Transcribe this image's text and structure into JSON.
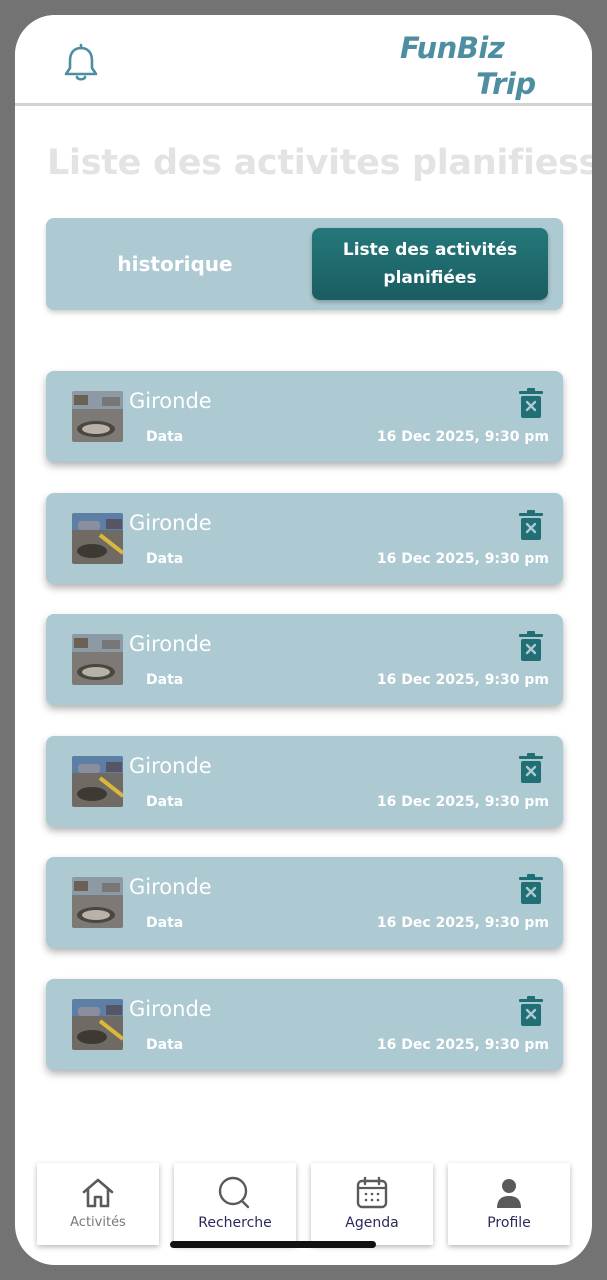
{
  "header": {
    "logo_line1": "FunBiz",
    "logo_line2": "Trip",
    "bell_icon": "bell-icon"
  },
  "page_title": "Liste des activites planifiess",
  "tabs": {
    "history_label": "historique",
    "planned_label_line1": "Liste des activités",
    "planned_label_line2": "planifiées"
  },
  "activities": [
    {
      "title": "Gironde",
      "subtitle": "Data",
      "date": "16 Dec 2025, 9:30 pm"
    },
    {
      "title": "Gironde",
      "subtitle": "Data",
      "date": "16 Dec 2025, 9:30 pm"
    },
    {
      "title": "Gironde",
      "subtitle": "Data",
      "date": "16 Dec 2025, 9:30 pm"
    },
    {
      "title": "Gironde",
      "subtitle": "Data",
      "date": "16 Dec 2025, 9:30 pm"
    },
    {
      "title": "Gironde",
      "subtitle": "Data",
      "date": "16 Dec 2025, 9:30 pm"
    },
    {
      "title": "Gironde",
      "subtitle": "Data",
      "date": "16 Dec 2025, 9:30 pm"
    }
  ],
  "nav": {
    "activites": "Activités",
    "recherche": "Recherche",
    "agenda": "Agenda",
    "profile": "Profile"
  },
  "colors": {
    "accent": "#4e8ea1",
    "card_bg": "#adc9d1",
    "active_tab": "#1f6a6d",
    "trash": "#1f6f74"
  }
}
